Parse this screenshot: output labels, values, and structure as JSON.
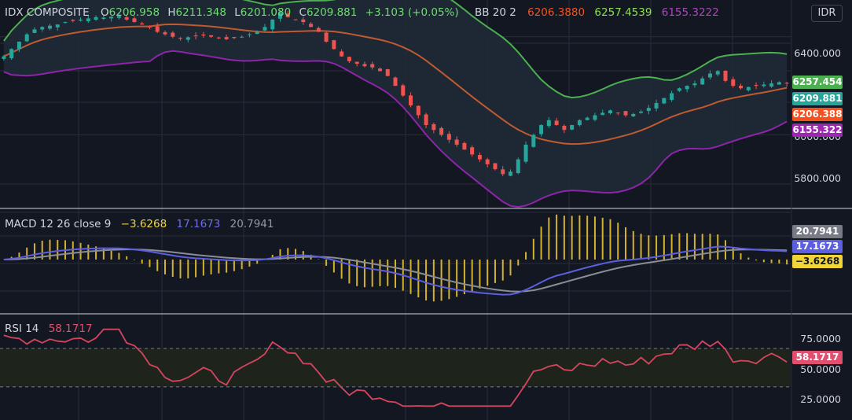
{
  "currency": "IDR",
  "price": {
    "symbol": "IDX COMPOSITE",
    "o_label": "O",
    "o": "6206.958",
    "h_label": "H",
    "h": "6211.348",
    "l_label": "L",
    "l": "6201.080",
    "c_label": "C",
    "c": "6209.881",
    "change": "+3.103 (+0.05%)",
    "bb_label": "BB 20 2",
    "bb_mid": "6206.3880",
    "bb_up": "6257.4539",
    "bb_low": "6155.3222",
    "y_ticks": [
      "6400.000",
      "6000.000",
      "5800.000"
    ],
    "badges": [
      {
        "text": "6257.454",
        "color": "#4caf50"
      },
      {
        "text": "6209.881",
        "color": "#26a69a"
      },
      {
        "text": "6206.388",
        "color": "#f4511e"
      },
      {
        "text": "6155.322",
        "color": "#9c27b0"
      }
    ]
  },
  "macd": {
    "label": "MACD 12 26 close 9",
    "hist": "−3.6268",
    "macd": "17.1673",
    "signal": "20.7941",
    "badges": [
      {
        "text": "20.7941",
        "color": "#787b86"
      },
      {
        "text": "17.1673",
        "color": "#5b5fe0"
      },
      {
        "text": "−3.6268",
        "color": "#f0d43a",
        "dark": true
      }
    ]
  },
  "rsi": {
    "label": "RSI 14",
    "value": "58.1717",
    "y_ticks": [
      "75.0000",
      "50.0000",
      "25.0000"
    ],
    "badge": {
      "text": "58.1717",
      "color": "#e0506e"
    }
  },
  "chart_data": {
    "type": "candlestick",
    "y_range_price": [
      5700,
      6550
    ],
    "close": [
      6320,
      6350,
      6380,
      6410,
      6430,
      6440,
      6445,
      6450,
      6460,
      6465,
      6470,
      6475,
      6480,
      6478,
      6482,
      6485,
      6470,
      6460,
      6450,
      6440,
      6420,
      6410,
      6400,
      6395,
      6398,
      6402,
      6405,
      6400,
      6395,
      6390,
      6395,
      6400,
      6410,
      6420,
      6440,
      6470,
      6500,
      6480,
      6470,
      6460,
      6440,
      6420,
      6380,
      6350,
      6320,
      6300,
      6290,
      6280,
      6275,
      6260,
      6240,
      6200,
      6160,
      6120,
      6080,
      6040,
      6020,
      6000,
      5980,
      5960,
      5940,
      5920,
      5900,
      5880,
      5860,
      5840,
      5850,
      5900,
      5960,
      6000,
      6040,
      6060,
      6040,
      6020,
      6040,
      6060,
      6070,
      6080,
      6090,
      6100,
      6090,
      6080,
      6085,
      6095,
      6110,
      6130,
      6150,
      6170,
      6190,
      6200,
      6210,
      6230,
      6250,
      6260,
      6220,
      6200,
      6190,
      6195,
      6200,
      6205,
      6210,
      6215,
      6210
    ]
  }
}
